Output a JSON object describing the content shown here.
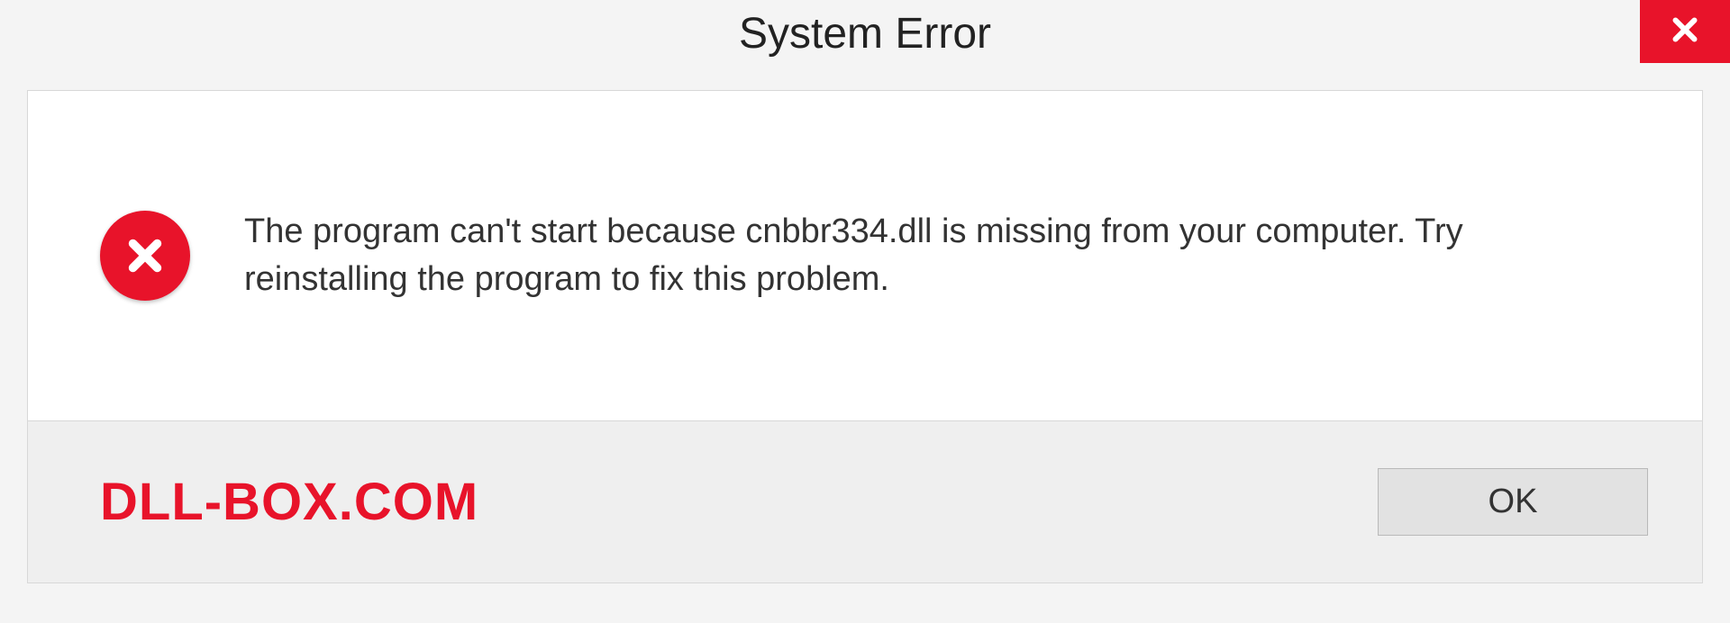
{
  "dialog": {
    "title": "System Error",
    "message": "The program can't start because cnbbr334.dll is missing from your computer. Try reinstalling the program to fix this problem.",
    "ok_label": "OK"
  },
  "watermark": "DLL-BOX.COM"
}
